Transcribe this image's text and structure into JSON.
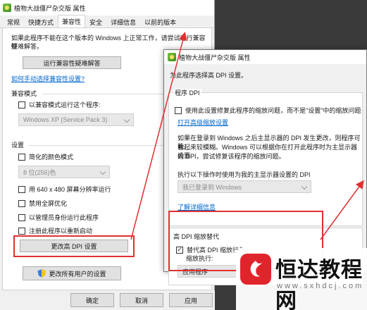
{
  "main_window": {
    "title": "植物大战僵尸杂交版 属性",
    "tabs": [
      "常规",
      "快捷方式",
      "兼容性",
      "安全",
      "详细信息",
      "以前的版本"
    ],
    "active_tab": "兼容性",
    "intro_line1": "如果此程序不能在这个版本的 Windows 上正常工作，请尝试运行兼容性",
    "intro_line2": "疑难解答。",
    "troubleshoot_button": "运行兼容性疑难解答",
    "manual_link": "如何手动选择兼容性设置?",
    "compat_mode_group": "兼容模式",
    "compat_mode_check": "以兼容模式运行这个程序:",
    "compat_mode_select": "Windows XP (Service Pack 3)",
    "settings_group": "设置",
    "reduced_color_check": "简化的颜色模式",
    "color_select": "8 位(256)色",
    "res_640_check": "用 640 x 480 屏幕分辨率运行",
    "disable_fullscreen_check": "禁用全屏优化",
    "run_admin_check": "以管理员身份运行此程序",
    "register_restart_check": "注册此程序以重新启动",
    "change_dpi_button": "更改高 DPI 设置",
    "all_users_button": "更改所有用户的设置",
    "ok_button": "确定",
    "cancel_button": "取消",
    "apply_button": "应用"
  },
  "dpi_dialog": {
    "title": "植物大战僵尸杂交版 属性",
    "heading": "为此程序选择高 DPI 设置。",
    "program_dpi_group": "程序 DPI",
    "program_dpi_check": "使用此设置修复此程序的缩放问题，而不是\"设置\"中的缩放问题",
    "open_adv_link": "打开高级缩放设置",
    "desc_line1": "如果在登录到 Windows 之后主显示器的 DPI 发生更改，则程序可能",
    "desc_line2": "看起来较模糊。Windows 可以根据你在打开此程序时为主显示器设置",
    "desc_line3": "的 DPI，尝试修复该程序的缩放问题。",
    "use_dpi_label": "执行以下操作时使用为我的主显示器设置的 DPI",
    "use_dpi_select": "我已登录到 Windows",
    "learn_more_link": "了解详细信息",
    "override_group": "高 DPI 缩放替代",
    "override_check": "替代高 DPI 缩放行为。",
    "override_checked": true,
    "scaling_label": "缩放执行:",
    "scaling_select": "应用程序"
  },
  "watermark": {
    "title": "恒达教程网",
    "subtitle": "www.sxhdcj.com"
  },
  "colors": {
    "highlight_red": "#e03030",
    "link_blue": "#0066cc",
    "brand_red": "#e0242c"
  }
}
